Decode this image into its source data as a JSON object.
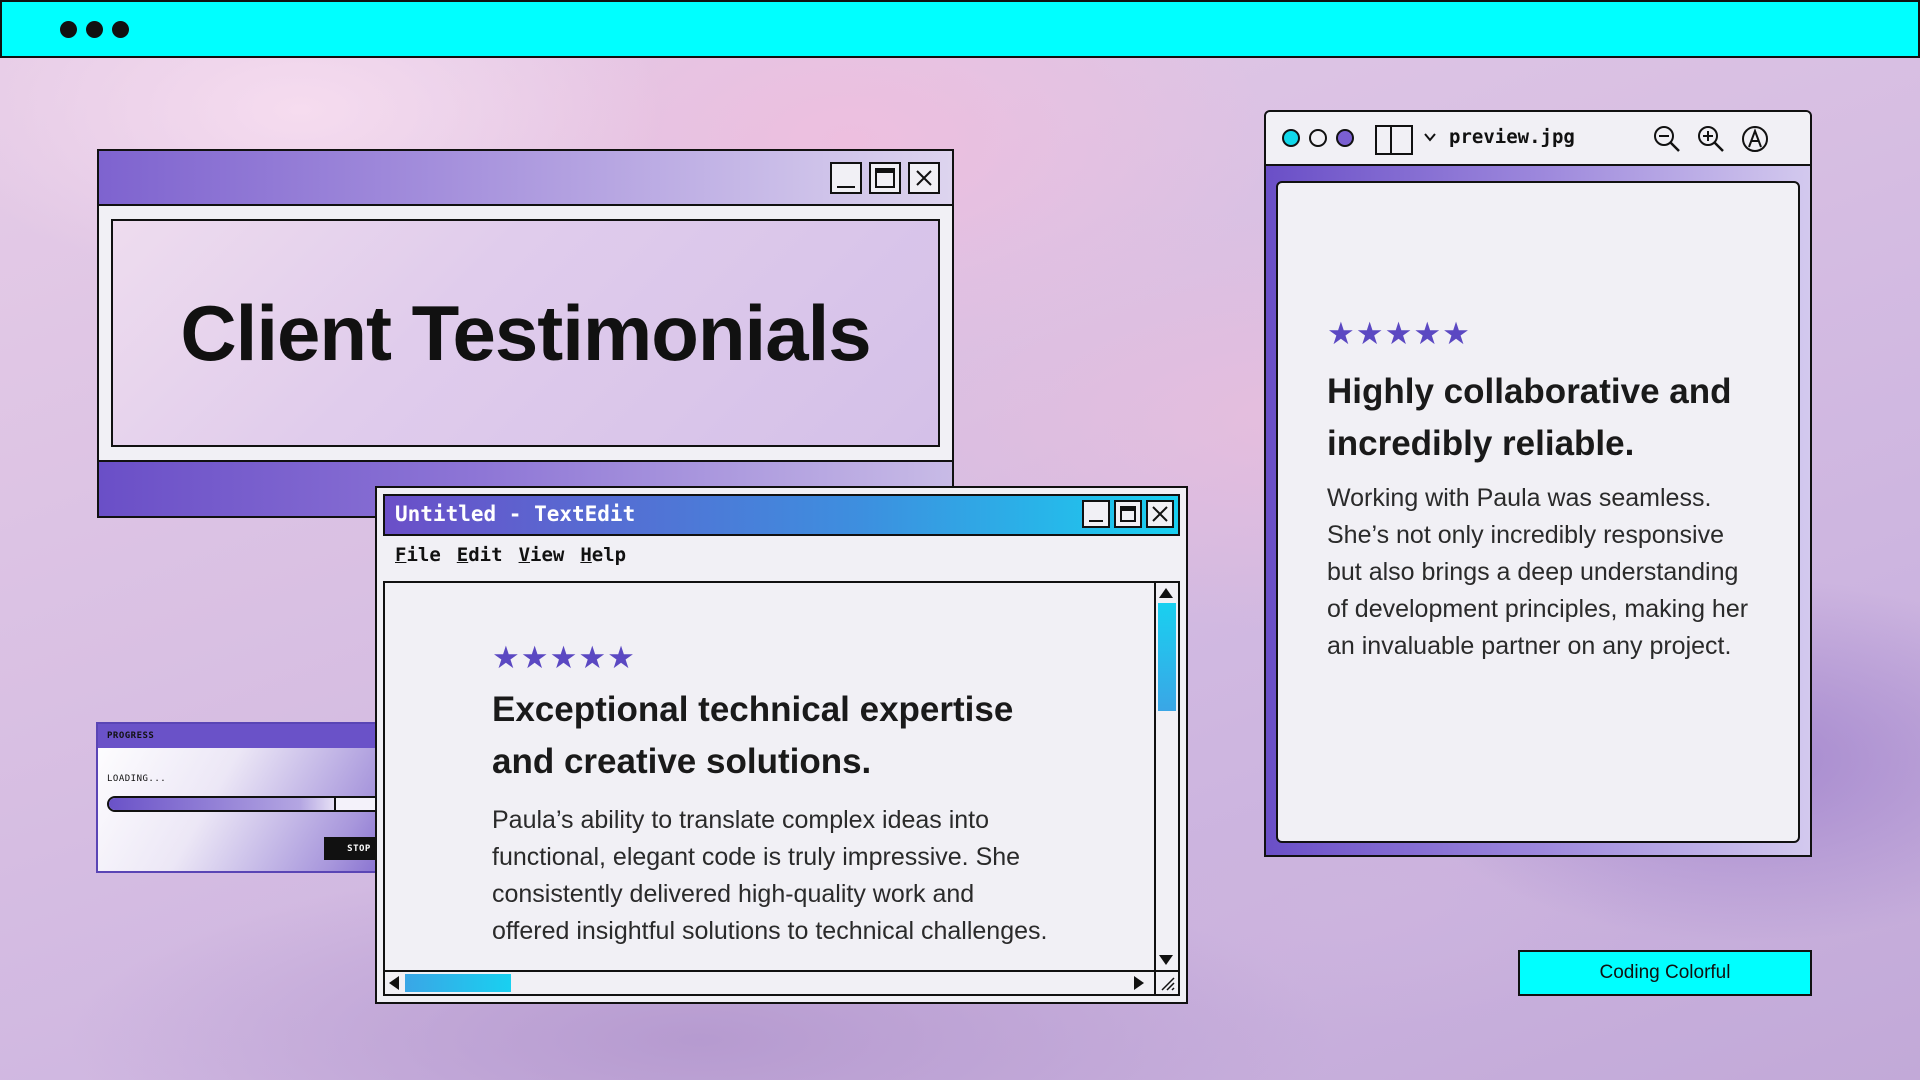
{
  "theme": {
    "accent_cyan": "#00FFFF",
    "purple": "#6A4FC7",
    "star_color": "#5B48C2",
    "panel_bg": "#F1F0F5"
  },
  "top_bar": {
    "dots": [
      "dot",
      "dot",
      "dot"
    ]
  },
  "title_window": {
    "heading": "Client Testimonials",
    "buttons": [
      "minimize-icon",
      "maximize-icon",
      "close-icon"
    ]
  },
  "progress_dialog": {
    "title": "PROGRESS",
    "status": "LOADING...",
    "progress_percent": 80,
    "stop_label": "STOP"
  },
  "textedit_window": {
    "title": "Untitled - TextEdit",
    "menu": [
      "File",
      "Edit",
      "View",
      "Help"
    ],
    "testimonial": {
      "stars": "★★★★★",
      "rating": 5,
      "headline": "Exceptional technical expertise and creative solutions.",
      "body": "Paula’s ability to translate complex ideas into functional, elegant code is truly impressive. She consistently delivered high-quality work and offered insightful solutions to technical challenges."
    }
  },
  "preview_window": {
    "filename": "preview.jpg",
    "tools": [
      "zoom-out-icon",
      "zoom-in-icon",
      "annotate-icon"
    ],
    "testimonial": {
      "stars": "★★★★★",
      "rating": 5,
      "headline": "Highly collaborative and incredibly reliable.",
      "body": "Working with Paula was seamless. She’s not only incredibly responsive but also brings a deep understanding of development principles, making her an invaluable partner on any project."
    }
  },
  "footer_tag": {
    "label": "Coding Colorful"
  }
}
